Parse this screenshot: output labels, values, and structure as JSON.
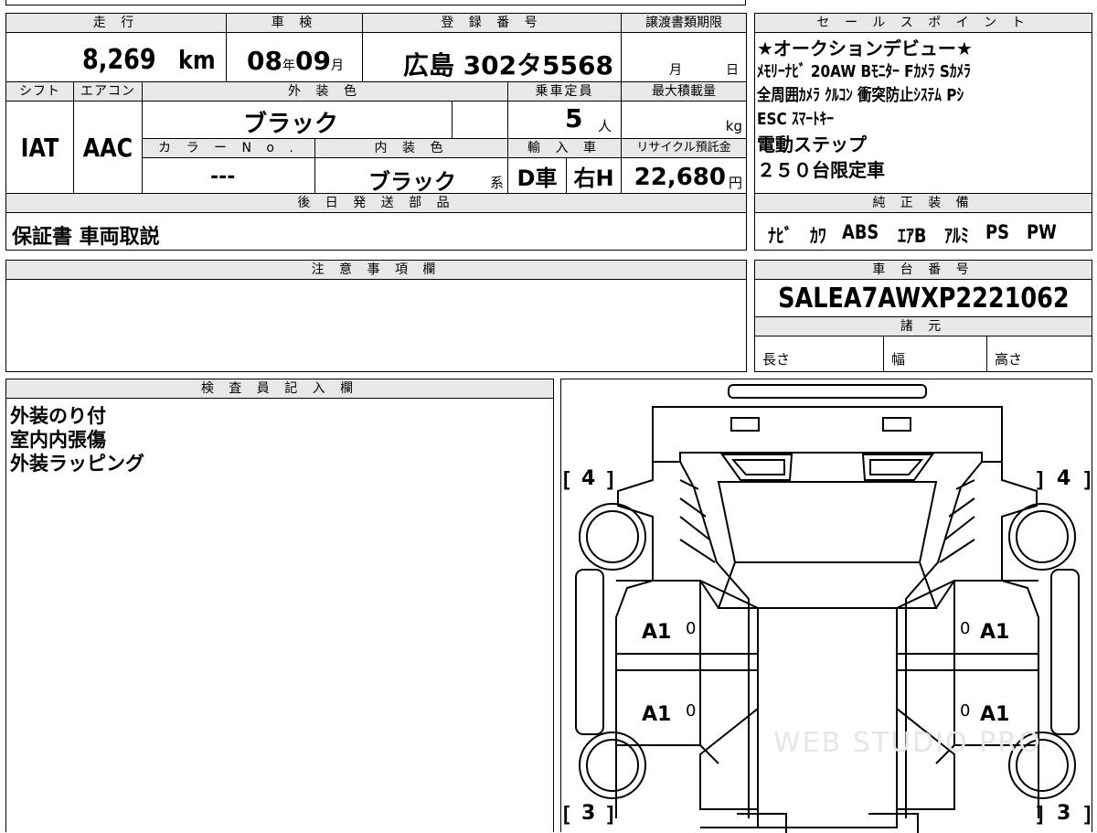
{
  "top": {
    "mileage_label": "走 行",
    "mileage_value": "8,269",
    "mileage_unit": "km",
    "inspection_label": "車 検",
    "inspection_year": "08",
    "inspection_year_unit": "年",
    "inspection_month": "09",
    "inspection_month_unit": "月",
    "registration_label": "登 録 番 号",
    "registration_value": "広島 302タ5568",
    "transfer_label": "譲渡書類期限",
    "transfer_month": "月",
    "transfer_day": "日"
  },
  "middle": {
    "shift_label": "シフト",
    "shift_value": "IAT",
    "aircon_label": "エアコン",
    "aircon_value": "AAC",
    "exterior_color_label": "外 装 色",
    "exterior_color_value": "ブラック",
    "capacity_label": "乗車定員",
    "capacity_value": "5",
    "capacity_unit": "人",
    "max_load_label": "最大積載量",
    "max_load_unit": "kg",
    "color_no_label": "カ ラ ー N o .",
    "color_no_value": "---",
    "interior_color_label": "内 装 色",
    "interior_color_value": "ブラック",
    "interior_color_suffix": "系",
    "import_label": "輸 入 車",
    "import_type": "D車",
    "import_handle": "右H",
    "recycle_label": "リサイクル預託金",
    "recycle_value": "22,680",
    "recycle_unit": "円"
  },
  "later_parts": {
    "label": "後 日 発 送 部 品",
    "value": "保証書 車両取説"
  },
  "sales_points": {
    "label": "セ ー ル ス ポ イ ン ト",
    "lines": [
      "★オークションデビュー★",
      "ﾒﾓﾘｰﾅﾋﾞ 20AW Bﾓﾆﾀｰ Fｶﾒﾗ Sｶﾒﾗ",
      "全周囲ｶﾒﾗ ｸﾙｺﾝ 衝突防止ｼｽﾃﾑ Pｼ",
      "ESC ｽﾏｰﾄｷｰ",
      "電動ステップ",
      "２５０台限定車"
    ]
  },
  "equipment": {
    "label": "純 正 装 備",
    "items": [
      "ﾅﾋﾞ",
      "ｶﾜ",
      "ABS",
      "ｴｱB",
      "ｱﾙﾐ",
      "PS",
      "PW"
    ]
  },
  "notes": {
    "label": "注 意 事 項 欄",
    "value": ""
  },
  "chassis": {
    "label": "車 台 番 号",
    "value": "SALEA7AWXP2221062",
    "specs_label": "諸 元",
    "length_label": "長さ",
    "width_label": "幅",
    "height_label": "高さ"
  },
  "inspector": {
    "label": "検 査 員 記 入 欄",
    "lines": [
      "外装のり付",
      "室内内張傷",
      "外装ラッピング"
    ]
  },
  "diagram": {
    "tire_front_left": "4",
    "tire_front_right": "4",
    "tire_rear_left": "3",
    "tire_rear_right": "3",
    "mark_lf": "A1",
    "mark_rf": "A1",
    "mark_lr": "A1",
    "mark_rr": "A1",
    "zero_lf": "0",
    "zero_rf": "0",
    "zero_lr": "0",
    "zero_rr": "0",
    "watermark": "WEB STUDIO PRO"
  }
}
